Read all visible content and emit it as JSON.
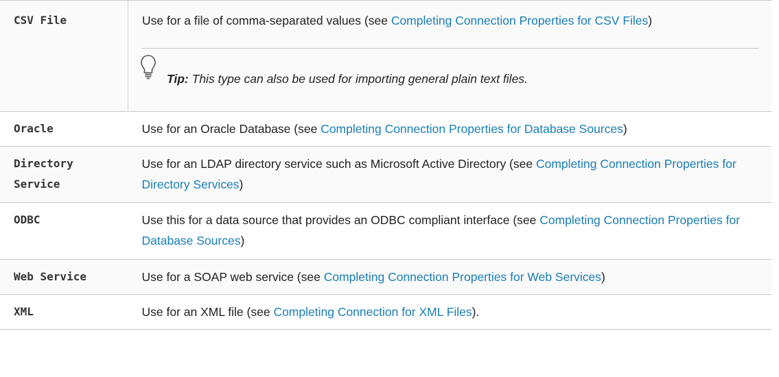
{
  "rows": [
    {
      "type": "CSV File",
      "desc_before": "Use for a file of comma-separated values (see ",
      "link": "Completing Connection Properties for CSV Files",
      "desc_after": ")",
      "tip": {
        "label": "Tip:",
        "text": " This type can also be used for importing general plain text files.",
        "icon": "lightbulb-icon"
      }
    },
    {
      "type": "Oracle",
      "desc_before": "Use for an Oracle Database (see ",
      "link": "Completing Connection Properties for Database Sources",
      "desc_after": ")"
    },
    {
      "type": "Directory Service",
      "desc_before": "Use for an LDAP directory service such as Microsoft Active Directory (see ",
      "link": "Completing Connection Properties for Directory Services",
      "desc_after": ")"
    },
    {
      "type": "ODBC",
      "desc_before": "Use this for a data source that provides an ODBC compliant interface (see ",
      "link": "Completing Connection Properties for Database Sources",
      "desc_after": ")"
    },
    {
      "type": "Web Service",
      "desc_before": "Use for a SOAP web service (see ",
      "link": "Completing Connection Properties for Web Services",
      "desc_after": ")"
    },
    {
      "type": "XML",
      "desc_before": "Use for an XML file (see ",
      "link": "Completing Connection for XML Files",
      "desc_after": ")."
    }
  ],
  "colors": {
    "link": "#1a7db5",
    "text": "#222222",
    "border": "#c8c8c8",
    "zebra": "#fafafa"
  }
}
